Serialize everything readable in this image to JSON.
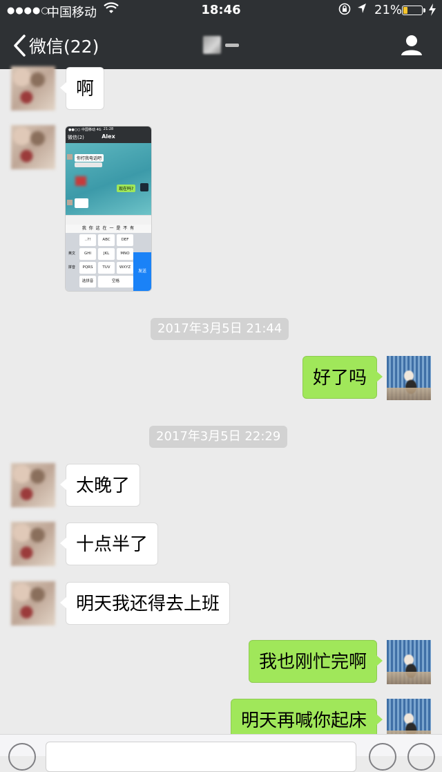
{
  "status_bar": {
    "signal": "●●●●○",
    "carrier": "中国移动",
    "time": "18:46",
    "battery": "21%",
    "battery_level": 0.21
  },
  "nav": {
    "back_label": "微信(22)"
  },
  "messages": [
    {
      "side": "in",
      "type": "text",
      "text": "啊"
    },
    {
      "side": "in",
      "type": "image"
    },
    {
      "type": "timestamp",
      "text": "2017年3月5日 21:44"
    },
    {
      "side": "out",
      "type": "text",
      "text": "好了吗"
    },
    {
      "type": "timestamp",
      "text": "2017年3月5日 22:29"
    },
    {
      "side": "in",
      "type": "text",
      "text": "太晚了"
    },
    {
      "side": "in",
      "type": "text",
      "text": "十点半了"
    },
    {
      "side": "in",
      "type": "text",
      "text": "明天我还得去上班"
    },
    {
      "side": "out",
      "type": "text",
      "text": "我也刚忙完啊"
    },
    {
      "side": "out",
      "type": "text",
      "text": "明天再喊你起床"
    }
  ],
  "embedded_screenshot": {
    "back": "微信(2)",
    "title": "Alex",
    "time": "21:28",
    "msg_in": "你打我电话吧",
    "msg_out": "现在吗?",
    "candidates": "我 你 这 在 一 是 不 有",
    "keys": [
      "..?!",
      "ABC",
      "DEF",
      "GHI",
      "JKL",
      "MNO",
      "PQRS",
      "TUV",
      "WXYZ",
      "选拼音",
      "空格"
    ],
    "side_keys": [
      "英文",
      "拼音"
    ],
    "send": "发送"
  },
  "colors": {
    "header": "#2e3134",
    "background": "#ebebeb",
    "bubble_out": "#a0e75a",
    "bubble_in": "#ffffff",
    "battery": "#f7c52b"
  }
}
